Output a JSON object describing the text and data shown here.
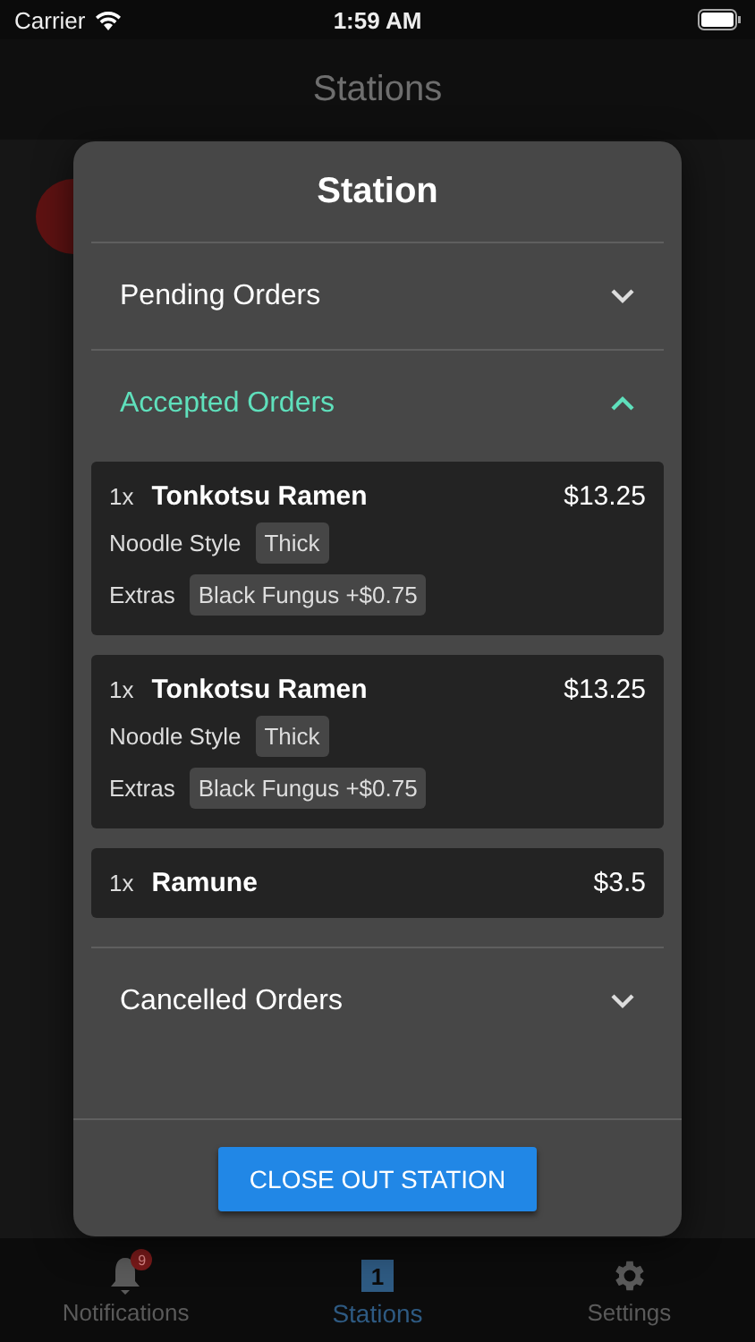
{
  "status_bar": {
    "carrier": "Carrier",
    "time": "1:59 AM"
  },
  "header": {
    "title": "Stations"
  },
  "modal": {
    "title": "Station",
    "sections": [
      {
        "label": "Pending Orders",
        "expanded": false
      },
      {
        "label": "Accepted Orders",
        "expanded": true,
        "orders": [
          {
            "quantity": "1x",
            "name": "Tonkotsu Ramen",
            "price": "$13.25",
            "options": [
              {
                "label": "Noodle Style",
                "value": "Thick"
              },
              {
                "label": "Extras",
                "value": "Black Fungus +$0.75"
              }
            ]
          },
          {
            "quantity": "1x",
            "name": "Tonkotsu Ramen",
            "price": "$13.25",
            "options": [
              {
                "label": "Noodle Style",
                "value": "Thick"
              },
              {
                "label": "Extras",
                "value": "Black Fungus +$0.75"
              }
            ]
          },
          {
            "quantity": "1x",
            "name": "Ramune",
            "price": "$3.5"
          }
        ]
      },
      {
        "label": "Cancelled Orders",
        "expanded": false
      }
    ],
    "button": {
      "label": "CLOSE OUT STATION"
    }
  },
  "tabs": [
    {
      "kind": "bell",
      "label": "Notifications",
      "badge": "9",
      "selected": false
    },
    {
      "kind": "counter",
      "label": "Stations",
      "count": "1",
      "selected": true
    },
    {
      "kind": "gear",
      "label": "Settings",
      "selected": false
    }
  ]
}
